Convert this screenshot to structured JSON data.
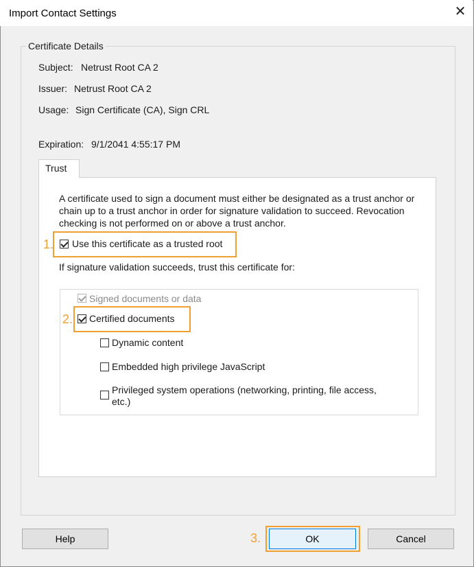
{
  "window": {
    "title": "Import Contact Settings"
  },
  "details": {
    "legend": "Certificate Details",
    "subject_label": "Subject:",
    "subject_value": "Netrust Root CA 2",
    "issuer_label": "Issuer:",
    "issuer_value": "Netrust Root CA 2",
    "usage_label": "Usage:",
    "usage_value": "Sign Certificate (CA), Sign CRL",
    "expiration_label": "Expiration:",
    "expiration_value": "9/1/2041 4:55:17 PM"
  },
  "tabs": [
    {
      "label": "Trust"
    }
  ],
  "trust": {
    "description_lines": [
      "A certificate used to sign a document must either be designated as a trust anchor or",
      "chain up to a trust anchor in order for signature validation to succeed.  Revocation",
      "checking is not performed on or above a trust anchor."
    ],
    "trusted_root_label": "Use this certificate as a trusted root",
    "trust_for_label": "If signature validation succeeds, trust this certificate for:",
    "options": {
      "signed": "Signed documents or data",
      "certified": "Certified documents",
      "dynamic": "Dynamic content",
      "javascript": "Embedded high privilege JavaScript",
      "privileged_line1": "Privileged system operations (networking, printing, file access,",
      "privileged_line2": "etc.)"
    }
  },
  "steps": {
    "one": "1.",
    "two": "2.",
    "three": "3."
  },
  "buttons": {
    "help": "Help",
    "ok": "OK",
    "cancel": "Cancel"
  },
  "colors": {
    "highlight": "#f0a030",
    "dialog_bg": "#f0f0f0",
    "primary_border": "#0078d7"
  }
}
